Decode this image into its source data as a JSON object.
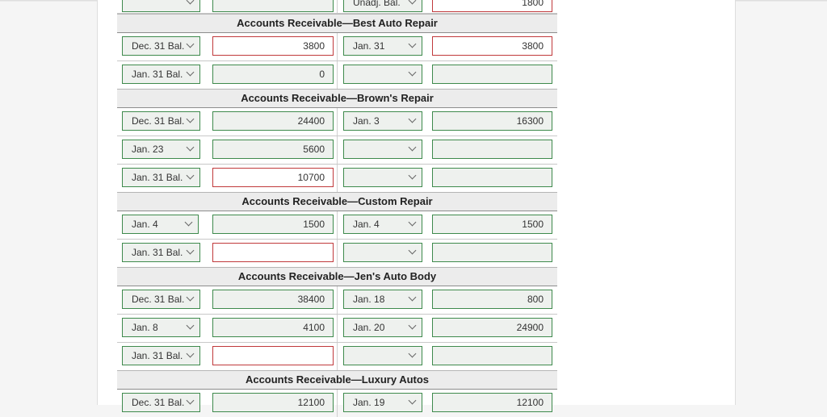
{
  "colors": {
    "accent_green": "#3e8a4c",
    "error_red": "#c0393b",
    "header_bg": "#ececec"
  },
  "icons": {
    "dropdown": "chevron-down-icon"
  },
  "partial_row": {
    "left_date": "",
    "left_amount": "",
    "right_date": "Unadj. Bal.",
    "right_amount": "1800"
  },
  "accounts": [
    {
      "title": "Accounts Receivable—Best Auto Repair",
      "rows": [
        {
          "left_date": "Dec. 31 Bal.",
          "left_amount": "3800",
          "right_date": "Jan. 31",
          "right_amount": "3800"
        },
        {
          "left_date": "Jan. 31 Bal.",
          "left_amount": "0",
          "right_date": "",
          "right_amount": ""
        }
      ]
    },
    {
      "title": "Accounts Receivable—Brown's Repair",
      "rows": [
        {
          "left_date": "Dec. 31 Bal.",
          "left_amount": "24400",
          "right_date": "Jan. 3",
          "right_amount": "16300"
        },
        {
          "left_date": "Jan. 23",
          "left_amount": "5600",
          "right_date": "",
          "right_amount": ""
        },
        {
          "left_date": "Jan. 31 Bal.",
          "left_amount": "10700",
          "right_date": "",
          "right_amount": ""
        }
      ]
    },
    {
      "title": "Accounts Receivable—Custom Repair",
      "rows": [
        {
          "left_date": "Jan. 4",
          "left_amount": "1500",
          "right_date": "Jan. 4",
          "right_amount": "1500"
        },
        {
          "left_date": "Jan. 31 Bal.",
          "left_amount": "",
          "right_date": "",
          "right_amount": ""
        }
      ]
    },
    {
      "title": "Accounts Receivable—Jen's Auto Body",
      "rows": [
        {
          "left_date": "Dec. 31 Bal.",
          "left_amount": "38400",
          "right_date": "Jan. 18",
          "right_amount": "800"
        },
        {
          "left_date": "Jan. 8",
          "left_amount": "4100",
          "right_date": "Jan. 20",
          "right_amount": "24900"
        },
        {
          "left_date": "Jan. 31 Bal.",
          "left_amount": "",
          "right_date": "",
          "right_amount": ""
        }
      ]
    },
    {
      "title": "Accounts Receivable—Luxury Autos",
      "rows": [
        {
          "left_date": "Dec. 31 Bal.",
          "left_amount": "12100",
          "right_date": "Jan. 19",
          "right_amount": "12100"
        }
      ]
    }
  ]
}
